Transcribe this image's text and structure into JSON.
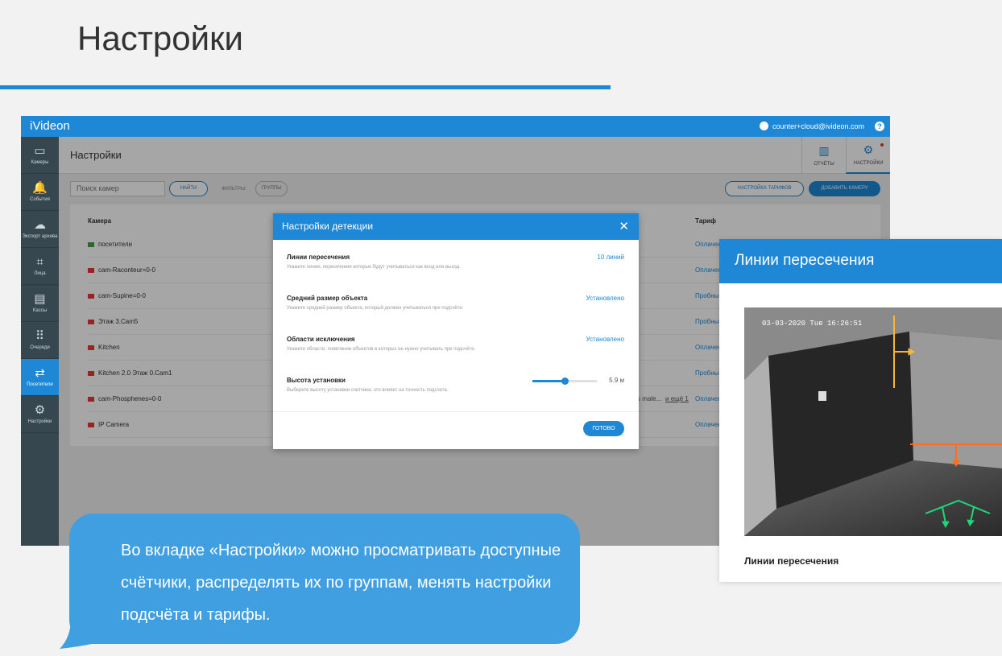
{
  "page": {
    "title": "Настройки"
  },
  "app": {
    "logo": "iVideon",
    "account": "counter+cloud@ivideon.com",
    "help_icon": "?",
    "sidebar": [
      {
        "label": "Камеры",
        "icon": "camera-icon",
        "glyph": "▭"
      },
      {
        "label": "События",
        "icon": "bell-icon",
        "glyph": "🔔"
      },
      {
        "label": "Экспорт архива",
        "icon": "cloud-download-icon",
        "glyph": "☁"
      },
      {
        "label": "Лица",
        "icon": "face-scan-icon",
        "glyph": "⌗"
      },
      {
        "label": "Кассы",
        "icon": "register-icon",
        "glyph": "▤"
      },
      {
        "label": "Очереди",
        "icon": "queue-icon",
        "glyph": "⠿"
      },
      {
        "label": "Посетители",
        "icon": "visitors-arrows-icon",
        "glyph": "⇄"
      },
      {
        "label": "Настройки",
        "icon": "gear-icon",
        "glyph": "⚙"
      }
    ],
    "header": {
      "title": "Настройки",
      "tab_reports": "ОТЧЁТЫ",
      "tab_settings": "НАСТРОЙКИ"
    },
    "toolbar": {
      "search_placeholder": "Поиск камер",
      "find": "НАЙТИ",
      "filters": "ФИЛЬТРЫ:",
      "groups": "ГРУППЫ",
      "tariffs": "НАСТРОЙКА ТАРИФОВ",
      "add_camera": "ДОБАВИТЬ КАМЕРУ"
    },
    "table": {
      "col_camera": "Камера",
      "col_tariff": "Тариф",
      "rows": [
        {
          "camera": "посетители",
          "tariff": "Оплачен",
          "status": "online"
        },
        {
          "camera": "cam-Raconteur=0-0",
          "tariff": "Оплачен",
          "status": "offline"
        },
        {
          "camera": "cam-Supine=0-0",
          "tariff": "Пробный",
          "status": "offline"
        },
        {
          "camera": "Этаж 3.Cam5",
          "tariff": "Пробный",
          "status": "offline"
        },
        {
          "camera": "Kitchen",
          "tariff": "Оплачен",
          "status": "offline"
        },
        {
          "camera": "Kitchen 2.0 Этаж 0.Cam1",
          "tariff": "Пробный",
          "status": "offline"
        },
        {
          "camera": "cam-Phosphenes=0-0",
          "tariff": "Оплачен",
          "status": "offline",
          "extra": "s male...",
          "more": "и ещё 1"
        },
        {
          "camera": "IP Camera",
          "tariff": "Оплачен",
          "status": "offline"
        }
      ]
    },
    "modal": {
      "title": "Настройки детекции",
      "close": "✕",
      "sections": [
        {
          "heading": "Линии пересечения",
          "desc": "Укажите линии, пересечения которых будут учитываться как вход или выход.",
          "value": "10 линий"
        },
        {
          "heading": "Средний размер объекта",
          "desc": "Укажите средний размер объекта, который должен учитываться при подсчёте.",
          "value": "Установлено"
        },
        {
          "heading": "Области исключения",
          "desc": "Укажите области, появление объектов в которых не нужно учитывать при подсчёте.",
          "value": "Установлено"
        },
        {
          "heading": "Высота установки",
          "desc": "Выберете высоту установки счетчика, это влияет на точность подсчета.",
          "value": "5.9 м"
        }
      ],
      "height_slider_fraction": 0.5,
      "done": "ГОТОВО"
    }
  },
  "card": {
    "title": "Линии пересечения",
    "timestamp": "03-03-2020 Tue 16:26:51",
    "caption": "Линии пересечения",
    "line_colors": {
      "yellow": "#f7b733",
      "orange": "#ff6f1f",
      "green": "#1fd67a"
    }
  },
  "bubble": {
    "text": "Во вкладке «Настройки» можно просматривать доступные счётчики, распределять их по группам, менять настройки подсчёта и тарифы."
  }
}
